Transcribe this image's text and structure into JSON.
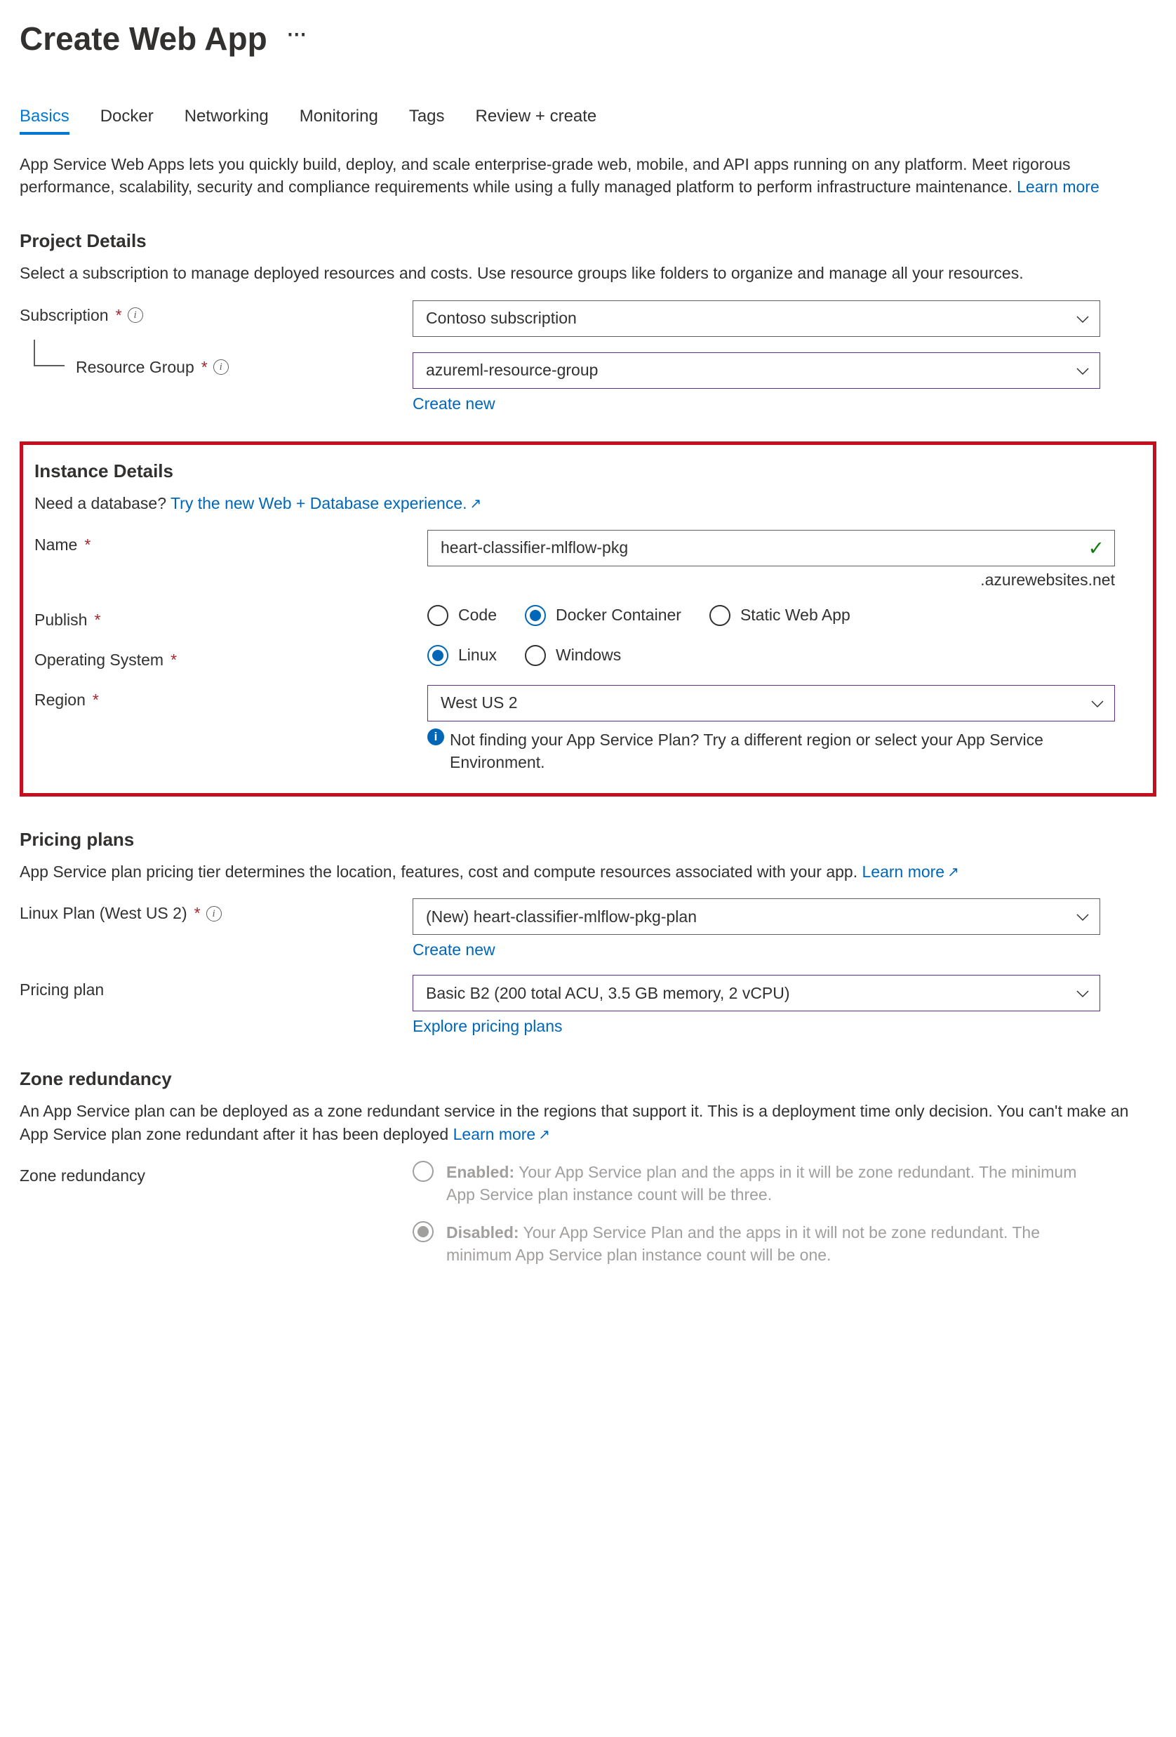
{
  "page_title": "Create Web App",
  "tabs": [
    "Basics",
    "Docker",
    "Networking",
    "Monitoring",
    "Tags",
    "Review + create"
  ],
  "active_tab_index": 0,
  "intro_text": "App Service Web Apps lets you quickly build, deploy, and scale enterprise-grade web, mobile, and API apps running on any platform. Meet rigorous performance, scalability, security and compliance requirements while using a fully managed platform to perform infrastructure maintenance.  ",
  "learn_more": "Learn more",
  "project_details": {
    "heading": "Project Details",
    "desc": "Select a subscription to manage deployed resources and costs. Use resource groups like folders to organize and manage all your resources.",
    "subscription_label": "Subscription",
    "subscription_value": "Contoso subscription",
    "resource_group_label": "Resource Group",
    "resource_group_value": "azureml-resource-group",
    "create_new": "Create new"
  },
  "instance_details": {
    "heading": "Instance Details",
    "db_prompt": "Need a database? ",
    "db_link": "Try the new Web + Database experience.",
    "name_label": "Name",
    "name_value": "heart-classifier-mlflow-pkg",
    "name_suffix": ".azurewebsites.net",
    "publish_label": "Publish",
    "publish_options": [
      "Code",
      "Docker Container",
      "Static Web App"
    ],
    "publish_selected": 1,
    "os_label": "Operating System",
    "os_options": [
      "Linux",
      "Windows"
    ],
    "os_selected": 0,
    "region_label": "Region",
    "region_value": "West US 2",
    "region_hint": "Not finding your App Service Plan? Try a different region or select your App Service Environment."
  },
  "pricing": {
    "heading": "Pricing plans",
    "desc": "App Service plan pricing tier determines the location, features, cost and compute resources associated with your app. ",
    "learn_more": "Learn more",
    "plan_label": "Linux Plan (West US 2)",
    "plan_value": "(New) heart-classifier-mlflow-pkg-plan",
    "create_new": "Create new",
    "pricing_plan_label": "Pricing plan",
    "pricing_plan_value": "Basic B2 (200 total ACU, 3.5 GB memory, 2 vCPU)",
    "explore": "Explore pricing plans"
  },
  "zone": {
    "heading": "Zone redundancy",
    "desc": "An App Service plan can be deployed as a zone redundant service in the regions that support it. This is a deployment time only decision. You can't make an App Service plan zone redundant after it has been deployed  ",
    "learn_more": "Learn more",
    "label": "Zone redundancy",
    "enabled_title": "Enabled:",
    "enabled_desc": " Your App Service plan and the apps in it will be zone redundant. The minimum App Service plan instance count will be three.",
    "disabled_title": "Disabled:",
    "disabled_desc": " Your App Service Plan and the apps in it will not be zone redundant. The minimum App Service plan instance count will be one."
  }
}
